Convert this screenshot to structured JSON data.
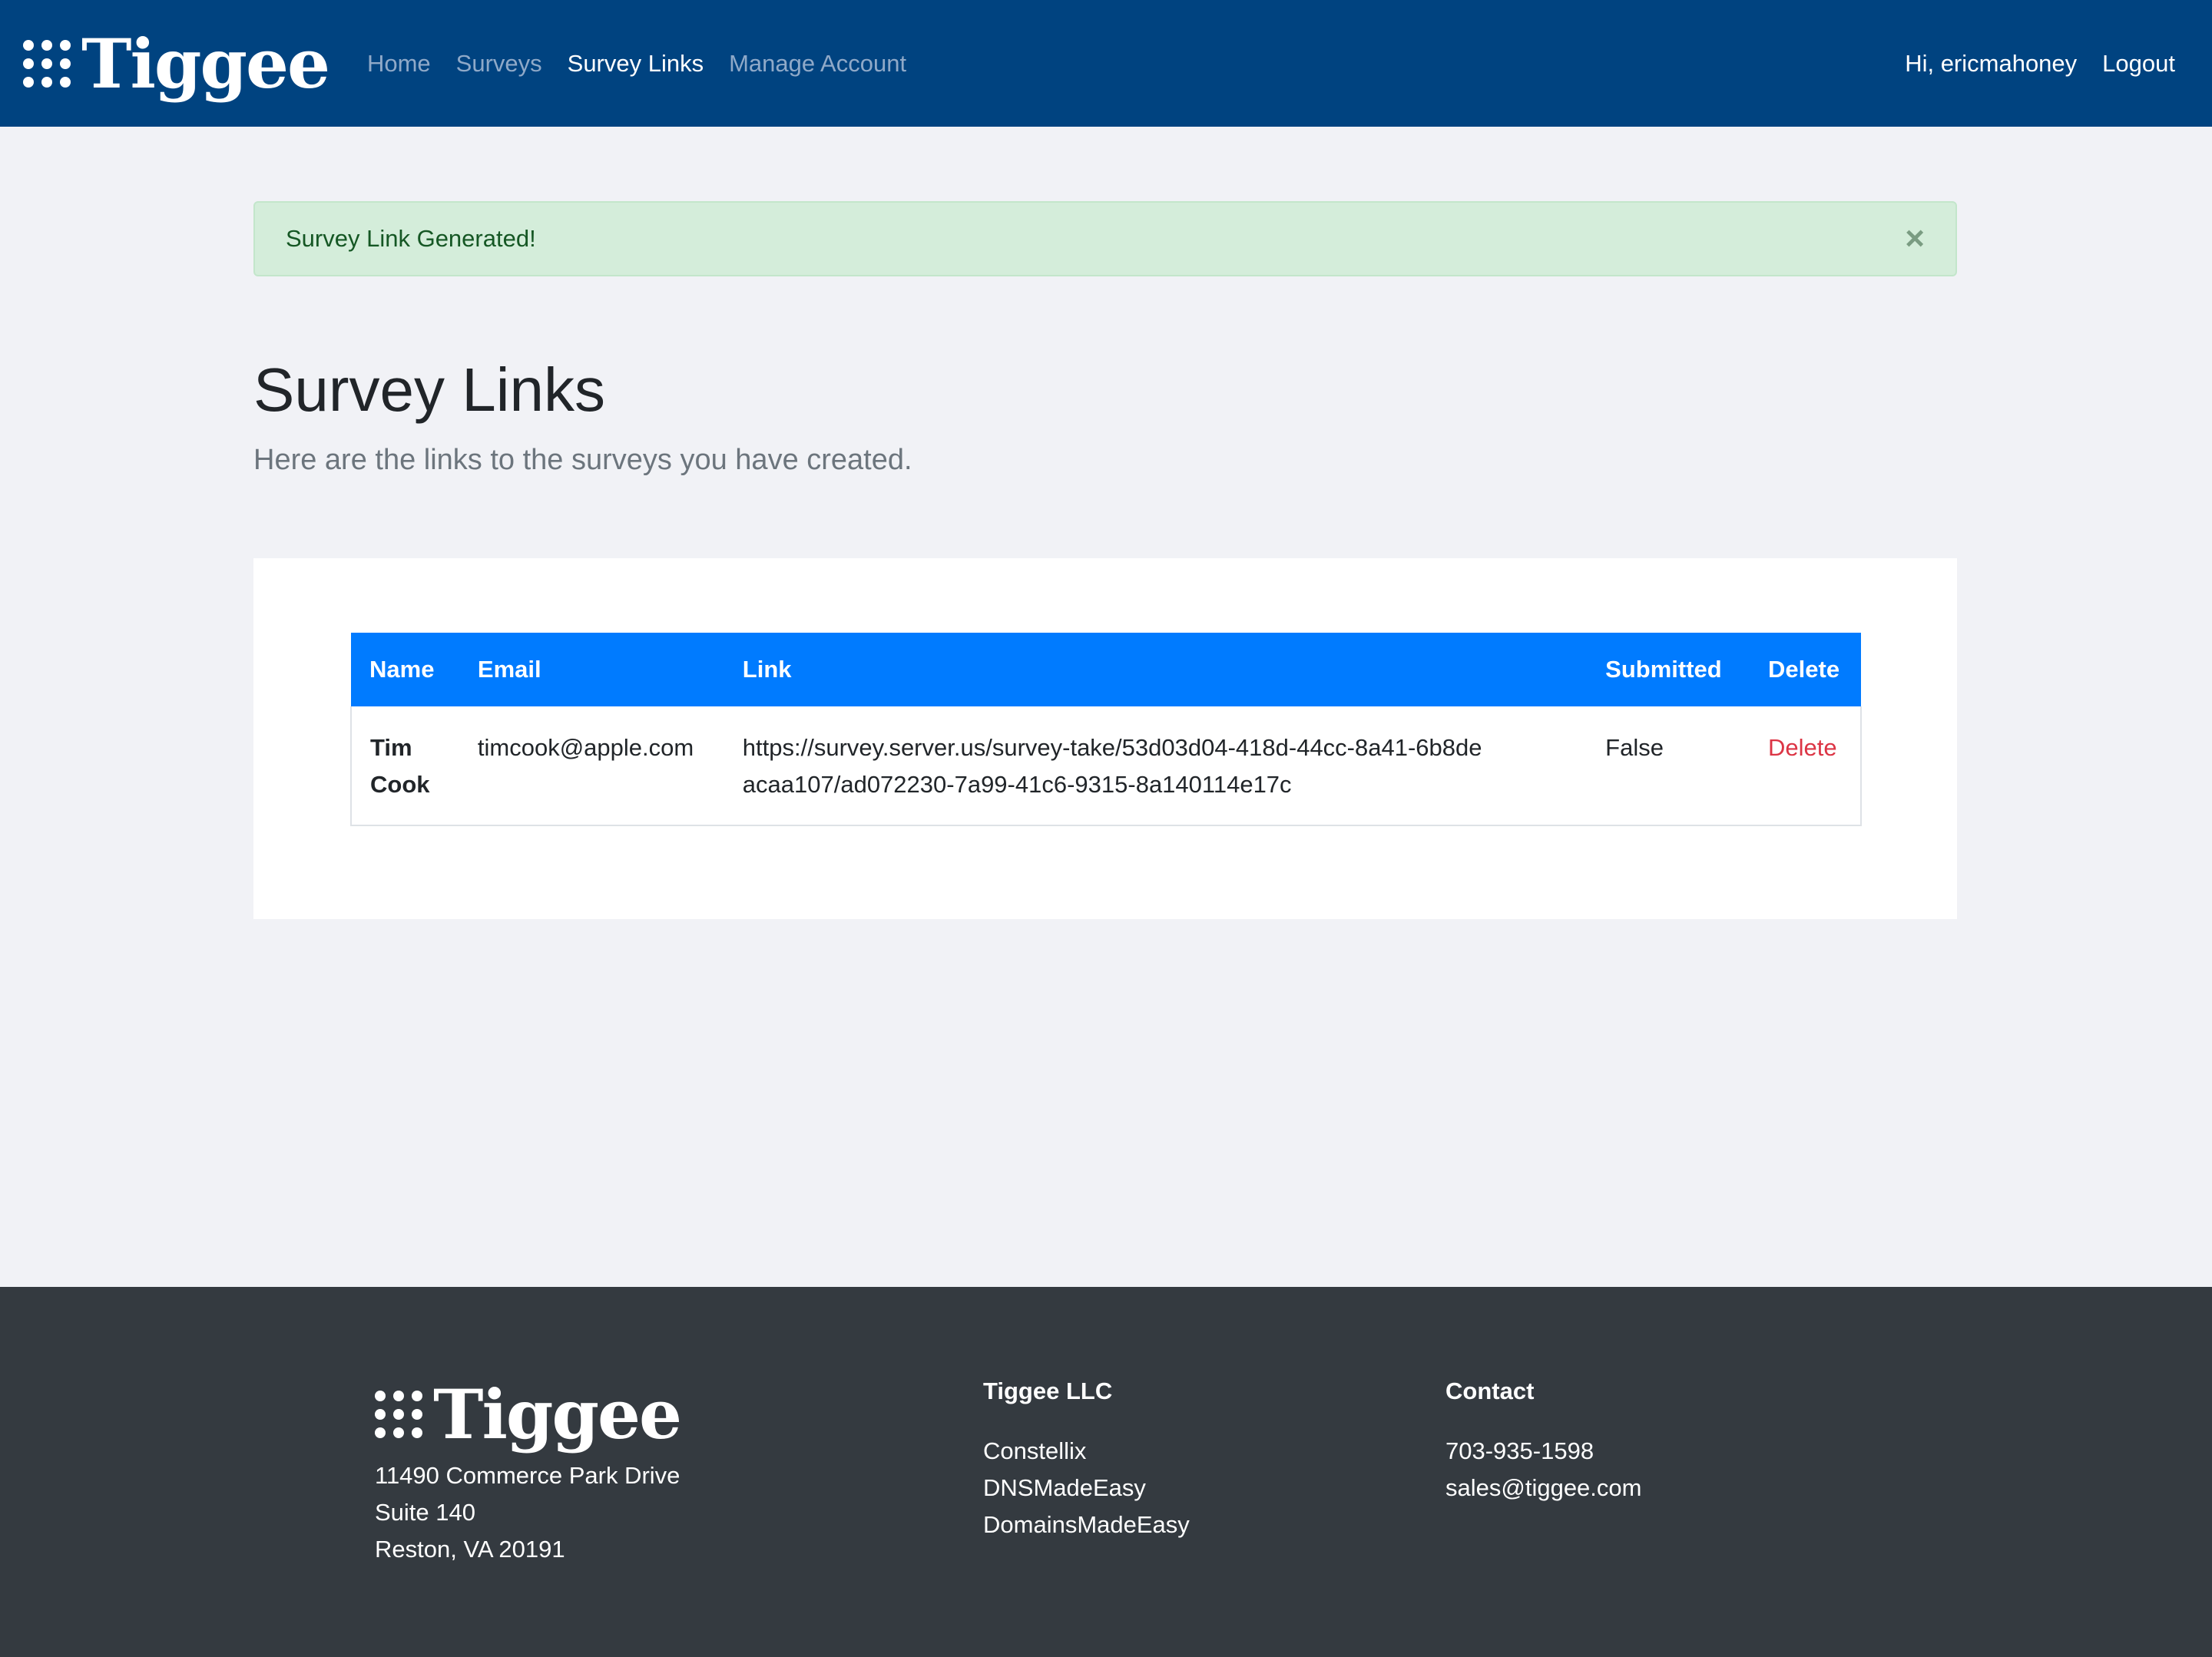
{
  "navbar": {
    "brand": "Tiggee",
    "links": [
      {
        "label": "Home",
        "active": false
      },
      {
        "label": "Surveys",
        "active": false
      },
      {
        "label": "Survey Links",
        "active": true
      },
      {
        "label": "Manage Account",
        "active": false
      }
    ],
    "greeting": "Hi, ericmahoney",
    "logout": "Logout"
  },
  "alert": {
    "message": "Survey Link Generated!",
    "close": "×"
  },
  "page": {
    "title": "Survey Links",
    "subtitle": "Here are the links to the surveys you have created."
  },
  "table": {
    "headers": [
      "Name",
      "Email",
      "Link",
      "Submitted",
      "Delete"
    ],
    "rows": [
      {
        "name": "Tim Cook",
        "email": "timcook@apple.com",
        "link": "https://survey.server.us/survey-take/53d03d04-418d-44cc-8a41-6b8deacaa107/ad072230-7a99-41c6-9315-8a140114e17c",
        "submitted": "False",
        "delete": "Delete"
      }
    ]
  },
  "footer": {
    "brand": "Tiggee",
    "address": [
      "11490 Commerce Park Drive",
      "Suite 140",
      "Reston, VA 20191"
    ],
    "company": {
      "heading": "Tiggee LLC",
      "links": [
        "Constellix",
        "DNSMadeEasy",
        "DomainsMadeEasy"
      ]
    },
    "contact": {
      "heading": "Contact",
      "phone": "703-935-1598",
      "email": "sales@tiggee.com"
    }
  },
  "colors": {
    "navbar": "#004380",
    "table_header": "#007bff",
    "alert_bg": "#d4edda",
    "delete_link": "#dc3545",
    "footer": "#343a40"
  }
}
